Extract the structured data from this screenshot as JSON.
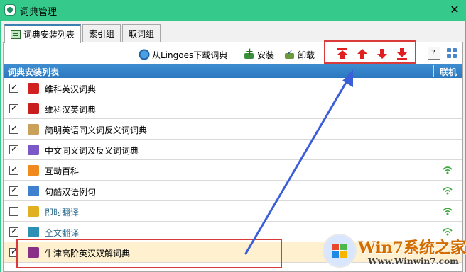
{
  "window": {
    "title": "词典管理",
    "close_glyph": "✕"
  },
  "tabs": [
    {
      "label": "词典安装列表",
      "active": true
    },
    {
      "label": "索引组",
      "active": false
    },
    {
      "label": "取词组",
      "active": false
    }
  ],
  "toolbar": {
    "download_label": "从Lingoes下载词典",
    "install_label": "安装",
    "uninstall_label": "卸载",
    "move_buttons": [
      {
        "name": "move-top",
        "icon": "arrow-to-top-icon"
      },
      {
        "name": "move-up",
        "icon": "arrow-up-icon"
      },
      {
        "name": "move-down",
        "icon": "arrow-down-icon"
      },
      {
        "name": "move-bottom",
        "icon": "arrow-to-bottom-icon"
      }
    ],
    "accent_color": "#e02020"
  },
  "list": {
    "header_name": "词典安装列表",
    "header_online": "联机",
    "rows": [
      {
        "label": "维科英汉词典",
        "checked": true,
        "online": false,
        "icon_color": "#d02020",
        "muted": false
      },
      {
        "label": "维科汉英词典",
        "checked": true,
        "online": false,
        "icon_color": "#c81e1e",
        "muted": false
      },
      {
        "label": "简明英语同义词反义词词典",
        "checked": true,
        "online": false,
        "icon_color": "#c9a15a",
        "muted": false
      },
      {
        "label": "中文同义词及反义词词典",
        "checked": true,
        "online": false,
        "icon_color": "#7a58c8",
        "muted": false
      },
      {
        "label": "互动百科",
        "checked": true,
        "online": true,
        "icon_color": "#f08a1c",
        "muted": false
      },
      {
        "label": "句酷双语例句",
        "checked": true,
        "online": true,
        "icon_color": "#3f7fd0",
        "muted": false
      },
      {
        "label": "即时翻译",
        "checked": false,
        "online": true,
        "icon_color": "#e0b020",
        "muted": true
      },
      {
        "label": "全文翻译",
        "checked": true,
        "online": true,
        "icon_color": "#2e8fb5",
        "muted": true
      },
      {
        "label": "牛津高阶英汉双解词典",
        "checked": true,
        "online": false,
        "icon_color": "#8a2f86",
        "muted": false,
        "selected": true
      }
    ]
  },
  "watermark": {
    "title": "Win7系统之家",
    "url": "Www.Winwin7.com"
  }
}
